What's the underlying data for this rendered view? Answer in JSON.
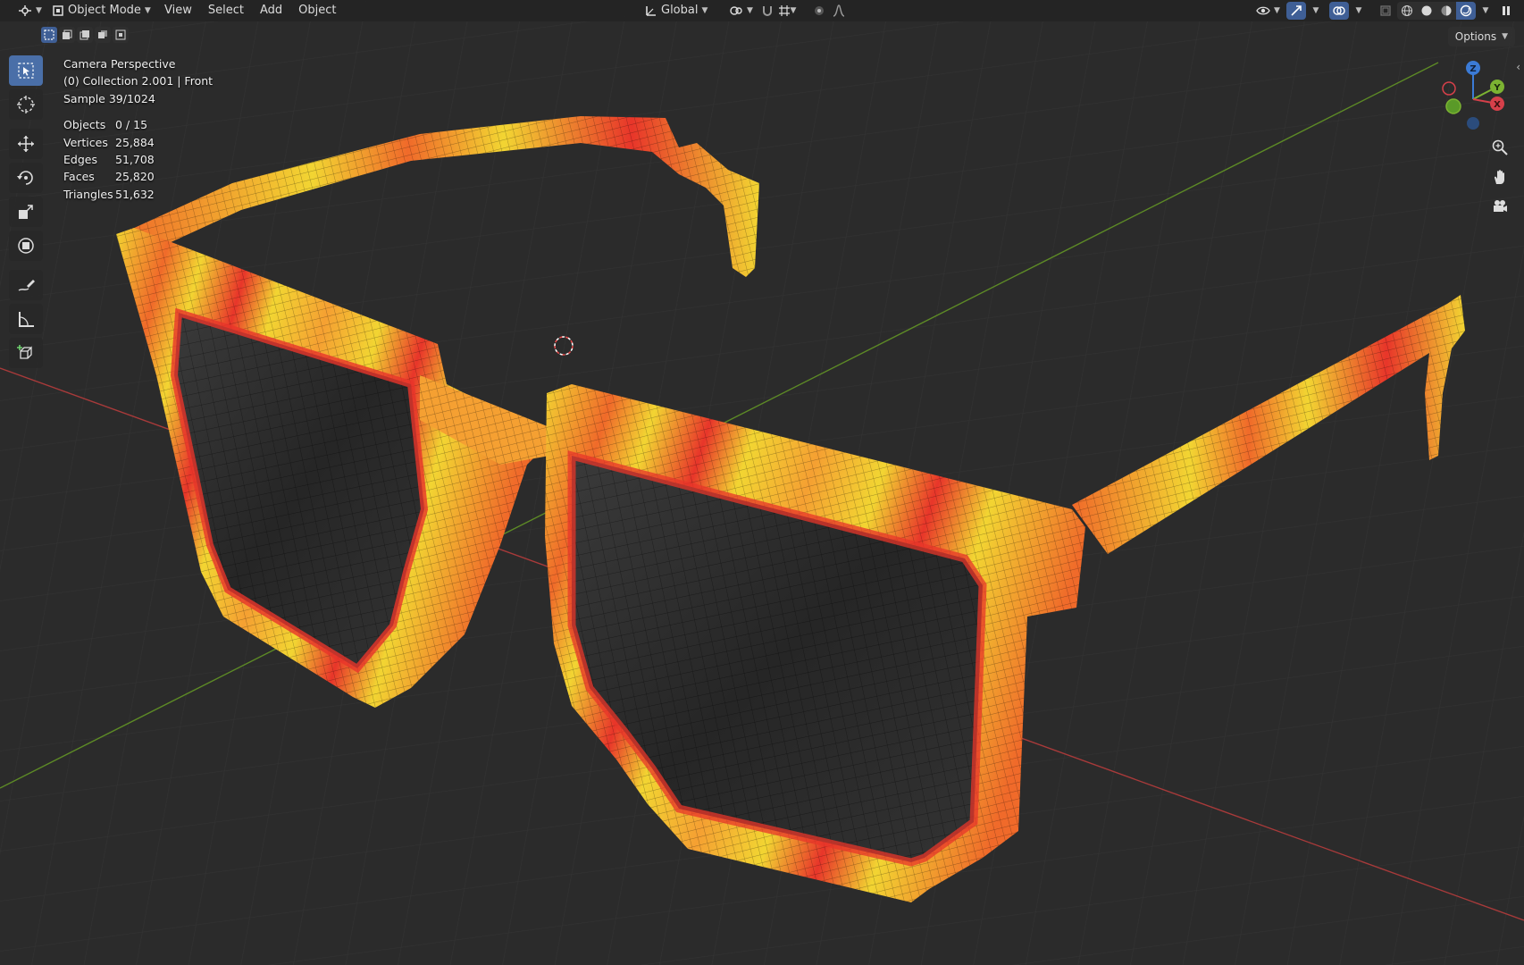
{
  "header": {
    "mode": "Object Mode",
    "menus": [
      "View",
      "Select",
      "Add",
      "Object"
    ],
    "orientation": "Global"
  },
  "options_label": "Options",
  "overlay": {
    "view_name": "Camera Perspective",
    "collection": "(0) Collection 2.001 | Front",
    "sample": "Sample 39/1024",
    "stats": [
      {
        "label": "Objects",
        "value": "0 / 15"
      },
      {
        "label": "Vertices",
        "value": "25,884"
      },
      {
        "label": "Edges",
        "value": "51,708"
      },
      {
        "label": "Faces",
        "value": "25,820"
      },
      {
        "label": "Triangles",
        "value": "51,632"
      }
    ]
  },
  "gizmo": {
    "x": "X",
    "y": "Y",
    "z": "Z"
  },
  "tools": [
    "select-box-icon",
    "cursor-icon",
    "move-icon",
    "rotate-icon",
    "scale-icon",
    "transform-icon",
    "annotate-icon",
    "measure-icon",
    "add-cube-icon"
  ],
  "colors": {
    "background": "#2b2b2b",
    "grid": "#333333",
    "x_axis": "#c94a4a",
    "y_axis": "#6a9b2c",
    "frame_orange": "#f06a2a",
    "frame_yellow": "#f2d532",
    "frame_red": "#e8352a",
    "lens": "#2c2c2c",
    "accent": "#4a6fa8"
  }
}
